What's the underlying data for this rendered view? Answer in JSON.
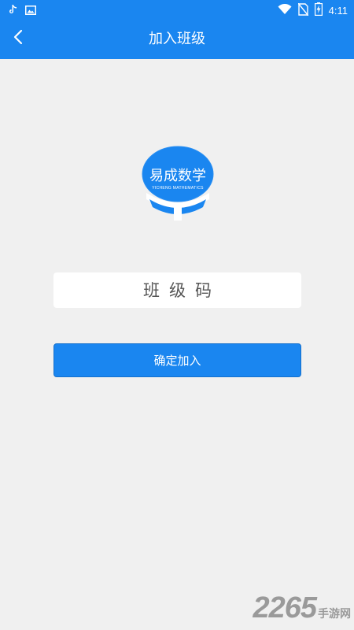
{
  "status_bar": {
    "time": "4:11",
    "battery_glyph": "⚡",
    "icons": [
      "tiktok-icon",
      "image-icon",
      "wifi-icon",
      "no-sim-icon",
      "battery-charging-icon"
    ]
  },
  "app_bar": {
    "title": "加入班级",
    "back_icon": "chevron-left-icon"
  },
  "logo": {
    "title": "易成数学",
    "subtitle": "YICHENG MATHEMATICS"
  },
  "form": {
    "class_code_placeholder": "班级码",
    "class_code_value": "",
    "submit_label": "确定加入"
  },
  "watermark": {
    "number": "2265",
    "text": "手游网"
  },
  "colors": {
    "primary": "#1a86f0",
    "background": "#f0f0f0",
    "input_bg": "#ffffff",
    "text_dark": "#555555"
  }
}
